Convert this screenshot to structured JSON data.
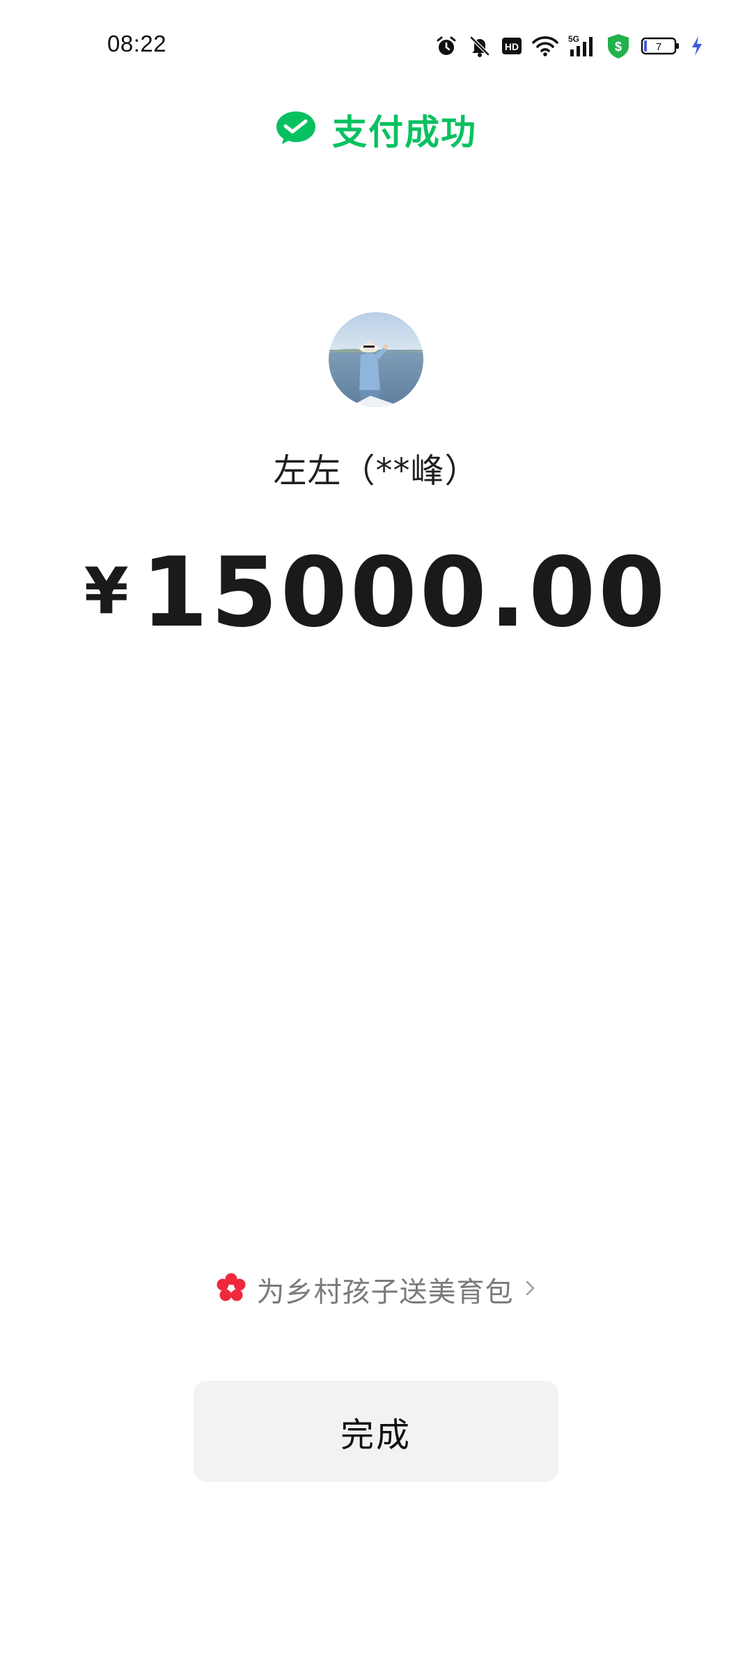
{
  "status_bar": {
    "time": "08:22",
    "network": "5G",
    "hd_label": "HD",
    "battery_level": "7",
    "icons": [
      "alarm-icon",
      "bell-off-icon",
      "hd-icon",
      "wifi-icon",
      "signal-5g-icon",
      "security-shield-icon",
      "battery-icon",
      "charging-icon"
    ],
    "shield_symbol": "$"
  },
  "header": {
    "title": "支付成功",
    "icon": "wechat-pay-check-icon",
    "accent_color": "#07c160"
  },
  "payee": {
    "name": "左左（**峰）"
  },
  "payment": {
    "currency": "¥",
    "amount": "15000.00"
  },
  "charity": {
    "label": "为乡村孩子送美育包",
    "icon": "flower-icon",
    "chevron": "›"
  },
  "actions": {
    "done_label": "完成"
  }
}
